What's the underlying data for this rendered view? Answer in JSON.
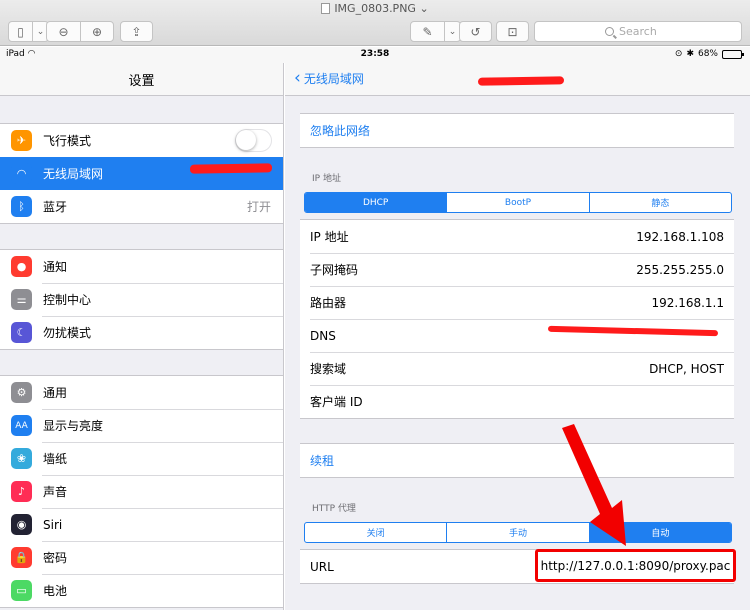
{
  "window": {
    "title": "IMG_0803.PNG",
    "search_placeholder": "Search"
  },
  "status": {
    "device": "iPad",
    "time": "23:58",
    "battery": "68%",
    "battery_level": 0.68
  },
  "left": {
    "title": "设置",
    "groups": [
      [
        {
          "label": "飞行模式",
          "icon": "airplane-icon",
          "color": "#ff9500",
          "value": "",
          "toggle": true
        },
        {
          "label": "无线局域网",
          "icon": "wifi-icon",
          "color": "#1f7ff0",
          "value": "",
          "selected": true
        },
        {
          "label": "蓝牙",
          "icon": "bluetooth-icon",
          "color": "#1f7ff0",
          "value": "打开"
        }
      ],
      [
        {
          "label": "通知",
          "icon": "notification-icon",
          "color": "#ff3b30",
          "value": ""
        },
        {
          "label": "控制中心",
          "icon": "control-center-icon",
          "color": "#8e8e93",
          "value": ""
        },
        {
          "label": "勿扰模式",
          "icon": "moon-icon",
          "color": "#5856d6",
          "value": ""
        }
      ],
      [
        {
          "label": "通用",
          "icon": "gear-icon",
          "color": "#8e8e93",
          "value": ""
        },
        {
          "label": "显示与亮度",
          "icon": "display-icon",
          "color": "#1f7ff0",
          "value": ""
        },
        {
          "label": "墙纸",
          "icon": "wallpaper-icon",
          "color": "#34aadc",
          "value": ""
        },
        {
          "label": "声音",
          "icon": "sound-icon",
          "color": "#ff2d55",
          "value": ""
        },
        {
          "label": "Siri",
          "icon": "siri-icon",
          "color": "#222233",
          "value": ""
        },
        {
          "label": "密码",
          "icon": "lock-icon",
          "color": "#ff3b30",
          "value": ""
        },
        {
          "label": "电池",
          "icon": "battery-icon",
          "color": "#4cd964",
          "value": ""
        }
      ]
    ]
  },
  "right": {
    "back_label": "无线局域网",
    "forget": "忽略此网络",
    "ip_section_label": "IP 地址",
    "ip_modes": [
      "DHCP",
      "BootP",
      "静态"
    ],
    "ip_mode_selected": 0,
    "ip_rows": [
      {
        "label": "IP 地址",
        "value": "192.168.1.108"
      },
      {
        "label": "子网掩码",
        "value": "255.255.255.0"
      },
      {
        "label": "路由器",
        "value": "192.168.1.1"
      },
      {
        "label": "DNS",
        "value": ""
      },
      {
        "label": "搜索域",
        "value": "DHCP, HOST"
      },
      {
        "label": "客户端 ID",
        "value": ""
      }
    ],
    "renew": "续租",
    "proxy_section_label": "HTTP 代理",
    "proxy_modes": [
      "关闭",
      "手动",
      "自动"
    ],
    "proxy_mode_selected": 2,
    "url_label": "URL",
    "url_value": "http://127.0.0.1:8090/proxy.pac"
  },
  "colors": {
    "accent": "#1f7ff0",
    "highlight": "#f20000"
  }
}
